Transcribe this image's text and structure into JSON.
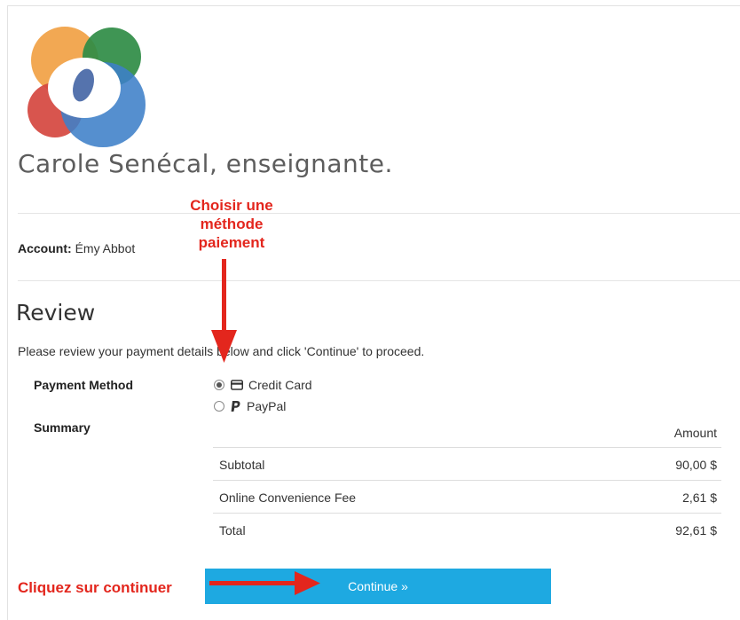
{
  "brand": {
    "title": "Carole Senécal, enseignante."
  },
  "account": {
    "label": "Account:",
    "name": "Émy Abbot"
  },
  "review": {
    "title": "Review",
    "instructions": "Please review your payment details below and click 'Continue' to proceed."
  },
  "payment": {
    "label": "Payment Method",
    "options": [
      {
        "label": "Credit Card",
        "icon": "credit-card-icon",
        "selected": true
      },
      {
        "label": "PayPal",
        "icon": "paypal-icon",
        "selected": false
      }
    ]
  },
  "summary": {
    "label": "Summary",
    "amount_header": "Amount",
    "rows": [
      {
        "label": "Subtotal",
        "amount": "90,00 $"
      },
      {
        "label": "Online Convenience Fee",
        "amount": "2,61 $"
      },
      {
        "label": "Total",
        "amount": "92,61 $"
      }
    ]
  },
  "continue_button": {
    "label": "Continue »"
  },
  "annotations": {
    "choose_method": [
      "Choisir une",
      "méthode",
      "paiement"
    ],
    "click_continue": "Cliquez sur continuer"
  },
  "colors": {
    "button": "#1ea9e1",
    "annotation": "#e3261d",
    "logo_orange": "#f1a34a",
    "logo_green": "#2f8c45",
    "logo_red": "#d5473f",
    "logo_blue": "#3d7fc8"
  }
}
